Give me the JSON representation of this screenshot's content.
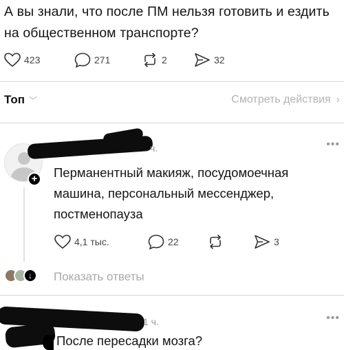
{
  "post": {
    "text": "А вы знали, что после ПМ нельзя готовить и ездить на общественном транспорте?",
    "likes": "423",
    "comments": "271",
    "reposts": "2",
    "shares": "32"
  },
  "sort": {
    "label": "Топ",
    "chevron": "﹀",
    "activity_link": "Смотреть действия",
    "activity_chevron": "›"
  },
  "comment1": {
    "time": "ч.",
    "more": "•••",
    "text": "Перманентный макияж, посудомоечная машина, персональный мессенджер, постменопауза",
    "likes": "4,1 тыс.",
    "comments": "22",
    "shares": "3",
    "follow_icon": "+"
  },
  "replies": {
    "label": "Показать ответы",
    "arrow": "↓"
  },
  "comment2": {
    "time": "1 ч.",
    "more": "•••",
    "text": "После пересадки мозга?"
  },
  "icons": {
    "like": "heart-icon",
    "comment": "comment-bubble-icon",
    "repost": "repost-icon",
    "share": "share-arrow-icon"
  },
  "colors": {
    "text": "#141414",
    "muted": "#a9a9a9",
    "redaction": "#0d0d0d"
  }
}
